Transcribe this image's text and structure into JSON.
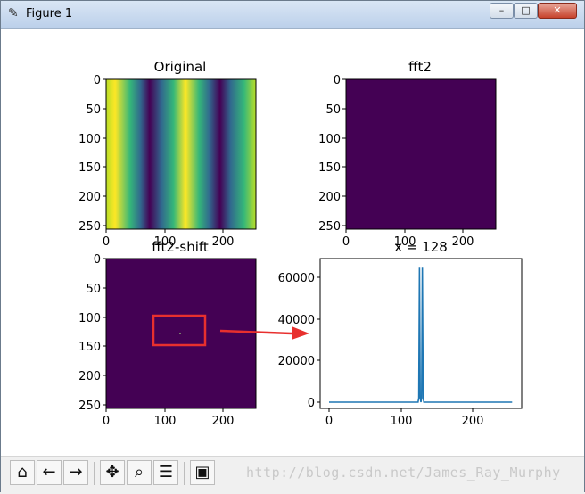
{
  "window": {
    "title": "Figure 1",
    "app_icon": "feather-icon",
    "min_icon": "minimize-icon",
    "max_icon": "maximize-icon",
    "close_icon": "close-icon"
  },
  "subplots": {
    "original": {
      "title": "Original",
      "yticks": [
        "0",
        "50",
        "100",
        "150",
        "200",
        "250"
      ],
      "xticks": [
        "0",
        "100",
        "200"
      ]
    },
    "fft2": {
      "title": "fft2",
      "yticks": [
        "0",
        "50",
        "100",
        "150",
        "200",
        "250"
      ],
      "xticks": [
        "0",
        "100",
        "200"
      ]
    },
    "fft2_shift": {
      "title": "fft2-shift",
      "yticks": [
        "0",
        "50",
        "100",
        "150",
        "200",
        "250"
      ],
      "xticks": [
        "0",
        "100",
        "200"
      ]
    },
    "slice": {
      "title": "x = 128",
      "yticks": [
        "0",
        "20000",
        "40000",
        "60000"
      ],
      "xticks": [
        "0",
        "100",
        "200"
      ]
    }
  },
  "colors": {
    "viridis_dark": "#440154",
    "viridis_yellow": "#fde725",
    "line": "#1f77b4",
    "annotation": "#e8302e"
  },
  "chart_data": [
    {
      "type": "heatmap",
      "title": "Original",
      "xlim": [
        0,
        256
      ],
      "ylim": [
        256,
        0
      ],
      "pattern": "vertical sinusoidal stripes"
    },
    {
      "type": "heatmap",
      "title": "fft2",
      "xlim": [
        0,
        256
      ],
      "ylim": [
        256,
        0
      ],
      "pattern": "uniform dark"
    },
    {
      "type": "heatmap",
      "title": "fft2-shift",
      "xlim": [
        0,
        256
      ],
      "ylim": [
        256,
        0
      ],
      "pattern": "single bright point at center"
    },
    {
      "type": "line",
      "title": "x = 128",
      "xlim": [
        0,
        256
      ],
      "ylim": [
        0,
        65536
      ],
      "x": [
        0,
        120,
        124,
        125,
        126,
        127,
        128,
        129,
        130,
        131,
        132,
        136,
        255
      ],
      "y": [
        0,
        0,
        0,
        2000,
        65000,
        2000,
        0,
        2000,
        65000,
        2000,
        0,
        0,
        0
      ]
    }
  ],
  "toolbar": {
    "home_icon": "home-icon",
    "back_icon": "back-arrow-icon",
    "forward_icon": "forward-arrow-icon",
    "pan_icon": "pan-icon",
    "zoom_icon": "zoom-icon",
    "configure_icon": "configure-subplots-icon",
    "save_icon": "save-icon"
  },
  "watermark": "http://blog.csdn.net/James_Ray_Murphy"
}
